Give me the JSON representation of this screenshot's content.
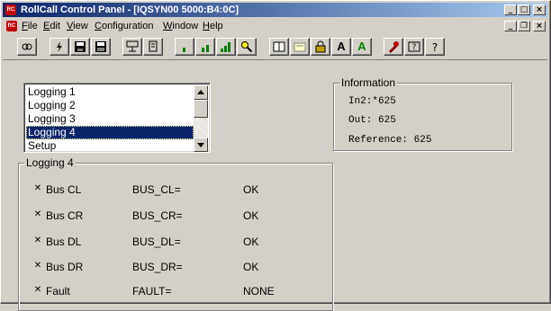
{
  "window": {
    "title": "RollCall Control Panel - [IQSYN00 5000:B4:0C]",
    "app_icon": "rollcall-app-icon",
    "caption_buttons": [
      "minimize",
      "maximize",
      "close"
    ]
  },
  "menu": {
    "items": [
      "File",
      "Edit",
      "View",
      "Configuration",
      "Window",
      "Help"
    ],
    "mdi_buttons": [
      "minimize",
      "restore",
      "close"
    ]
  },
  "toolbar": {
    "buttons": [
      "connect-icon",
      "flash-icon",
      "save-icon",
      "save-all-icon",
      "network-icon",
      "device-icon",
      "bar-small-icon",
      "bar-medium-icon",
      "bar-large-icon",
      "search-icon",
      "book-icon",
      "card-icon",
      "lock-icon",
      "font-a-icon",
      "font-a-green-icon",
      "tools-icon",
      "help-icon",
      "whats-this-icon"
    ],
    "letter_a": "A"
  },
  "list": {
    "items": [
      "Logging 1",
      "Logging 2",
      "Logging 3",
      "Logging 4",
      "Setup"
    ],
    "selected_index": 3
  },
  "information": {
    "title": "Information",
    "lines": [
      "In2:*625",
      "Out: 625",
      "Reference: 625"
    ]
  },
  "logging": {
    "title": "Logging 4",
    "rows": [
      {
        "checked": true,
        "name": "Bus CL",
        "key": "BUS_CL=",
        "value": "OK"
      },
      {
        "checked": true,
        "name": "Bus CR",
        "key": "BUS_CR=",
        "value": "OK"
      },
      {
        "checked": true,
        "name": "Bus DL",
        "key": "BUS_DL=",
        "value": "OK"
      },
      {
        "checked": true,
        "name": "Bus DR",
        "key": "BUS_DR=",
        "value": "OK"
      },
      {
        "checked": true,
        "name": "Fault",
        "key": "FAULT=",
        "value": "NONE"
      }
    ]
  },
  "colors": {
    "titlebar_start": "#0a246a",
    "titlebar_end": "#a6caf0",
    "face": "#d4d0c8",
    "selection": "#0a246a"
  }
}
